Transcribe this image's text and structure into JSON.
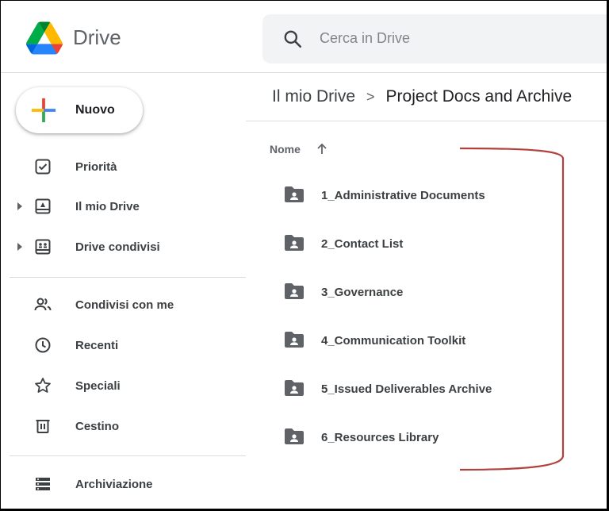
{
  "header": {
    "brand": "Drive",
    "search_placeholder": "Cerca in Drive"
  },
  "sidebar": {
    "new_label": "Nuovo",
    "items": [
      {
        "label": "Priorità",
        "icon": "priority-check-icon"
      },
      {
        "label": "Il mio Drive",
        "icon": "my-drive-icon"
      },
      {
        "label": "Drive condivisi",
        "icon": "shared-drives-icon"
      },
      {
        "label": "Condivisi con me",
        "icon": "shared-with-me-icon"
      },
      {
        "label": "Recenti",
        "icon": "clock-icon"
      },
      {
        "label": "Speciali",
        "icon": "star-icon"
      },
      {
        "label": "Cestino",
        "icon": "trash-icon"
      },
      {
        "label": "Archiviazione",
        "icon": "storage-icon"
      }
    ]
  },
  "breadcrumb": {
    "root": "Il mio Drive",
    "separator": ">",
    "current": "Project Docs and Archive"
  },
  "list": {
    "column_header": "Nome",
    "sort_direction": "ascending",
    "folders": [
      "1_Administrative Documents",
      "2_Contact List",
      "3_Governance",
      "4_Communication Toolkit",
      "5_Issued Deliverables Archive",
      "6_Resources Library"
    ]
  },
  "colors": {
    "bracket": "#b0413e",
    "folder": "#5f6368",
    "search_bg": "#f1f3f4"
  }
}
